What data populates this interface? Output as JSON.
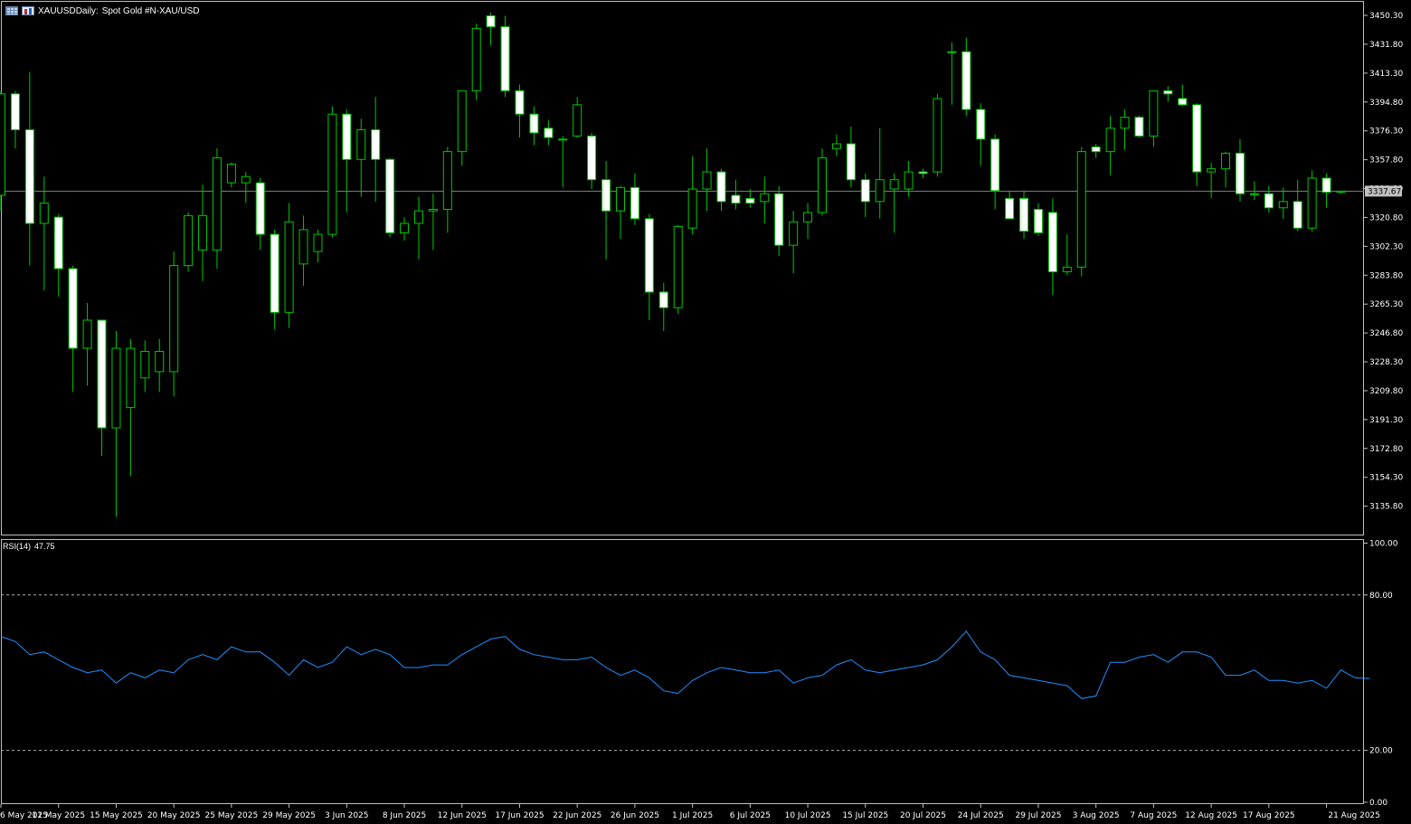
{
  "header": {
    "symbol": "XAUUSD",
    "timeframe": "Daily:",
    "description": "Spot Gold #N-XAU/USD"
  },
  "rsi": {
    "label": "RSI(14)",
    "value": "47.75"
  },
  "current_price_label": "3337.67",
  "colors": {
    "background": "#000000",
    "axis": "#c0c0c0",
    "candle_up_body": "#000000",
    "candle_down_body": "#ffffff",
    "candle_body_outline": "#00c800",
    "wick": "#00c800",
    "rsi_line": "#1e90ff",
    "level_line": "#b0b0b0",
    "price_line": "#808080"
  },
  "icons": [
    "grid-icon",
    "bar-chart-icon"
  ],
  "chart_data": [
    {
      "type": "candlestick",
      "title": "XAUUSD, Daily:  Spot Gold #N-XAU/USD",
      "ylim": [
        3120,
        3458
      ],
      "y_ticks": [
        "3450.30",
        "3431.80",
        "3413.30",
        "3394.80",
        "3376.30",
        "3357.80",
        "3339.30",
        "3320.80",
        "3302.30",
        "3283.80",
        "3265.30",
        "3246.80",
        "3228.30",
        "3209.80",
        "3191.30",
        "3172.80",
        "3154.30",
        "3135.80"
      ],
      "x_tick_labels": [
        "6 May 2025",
        "11 May 2025",
        "15 May 2025",
        "20 May 2025",
        "25 May 2025",
        "29 May 2025",
        "3 Jun 2025",
        "8 Jun 2025",
        "12 Jun 2025",
        "17 Jun 2025",
        "22 Jun 2025",
        "26 Jun 2025",
        "1 Jul 2025",
        "6 Jul 2025",
        "10 Jul 2025",
        "15 Jul 2025",
        "20 Jul 2025",
        "24 Jul 2025",
        "29 Jul 2025",
        "3 Aug 2025",
        "7 Aug 2025",
        "12 Aug 2025",
        "17 Aug 2025",
        "21 Aug 2025"
      ],
      "current_price": 3337.67,
      "candles": [
        {
          "o": 3335,
          "h": 3402,
          "l": 3325,
          "c": 3400
        },
        {
          "o": 3400,
          "h": 3402,
          "l": 3365,
          "c": 3377
        },
        {
          "o": 3377,
          "h": 3414,
          "l": 3290,
          "c": 3317
        },
        {
          "o": 3317,
          "h": 3347,
          "l": 3274,
          "c": 3330
        },
        {
          "o": 3321,
          "h": 3323,
          "l": 3270,
          "c": 3288
        },
        {
          "o": 3288,
          "h": 3290,
          "l": 3209,
          "c": 3237
        },
        {
          "o": 3237,
          "h": 3266,
          "l": 3213,
          "c": 3255
        },
        {
          "o": 3255,
          "h": 3255,
          "l": 3168,
          "c": 3186
        },
        {
          "o": 3186,
          "h": 3248,
          "l": 3129,
          "c": 3237
        },
        {
          "o": 3199,
          "h": 3243,
          "l": 3155,
          "c": 3237
        },
        {
          "o": 3218,
          "h": 3242,
          "l": 3209,
          "c": 3235
        },
        {
          "o": 3222,
          "h": 3243,
          "l": 3209,
          "c": 3235
        },
        {
          "o": 3222,
          "h": 3299,
          "l": 3206,
          "c": 3290
        },
        {
          "o": 3290,
          "h": 3324,
          "l": 3286,
          "c": 3322
        },
        {
          "o": 3300,
          "h": 3342,
          "l": 3280,
          "c": 3322
        },
        {
          "o": 3300,
          "h": 3365,
          "l": 3288,
          "c": 3359
        },
        {
          "o": 3343,
          "h": 3356,
          "l": 3340,
          "c": 3355
        },
        {
          "o": 3343,
          "h": 3350,
          "l": 3330,
          "c": 3347
        },
        {
          "o": 3343,
          "h": 3346,
          "l": 3300,
          "c": 3310
        },
        {
          "o": 3310,
          "h": 3313,
          "l": 3249,
          "c": 3260
        },
        {
          "o": 3260,
          "h": 3330,
          "l": 3250,
          "c": 3318
        },
        {
          "o": 3291,
          "h": 3322,
          "l": 3277,
          "c": 3313
        },
        {
          "o": 3299,
          "h": 3313,
          "l": 3292,
          "c": 3310
        },
        {
          "o": 3310,
          "h": 3392,
          "l": 3308,
          "c": 3387
        },
        {
          "o": 3387,
          "h": 3390,
          "l": 3324,
          "c": 3358
        },
        {
          "o": 3358,
          "h": 3384,
          "l": 3334,
          "c": 3377
        },
        {
          "o": 3377,
          "h": 3398,
          "l": 3331,
          "c": 3358
        },
        {
          "o": 3358,
          "h": 3359,
          "l": 3308,
          "c": 3311
        },
        {
          "o": 3311,
          "h": 3321,
          "l": 3306,
          "c": 3317
        },
        {
          "o": 3317,
          "h": 3334,
          "l": 3294,
          "c": 3325
        },
        {
          "o": 3325,
          "h": 3336,
          "l": 3300,
          "c": 3326
        },
        {
          "o": 3326,
          "h": 3366,
          "l": 3311,
          "c": 3363
        },
        {
          "o": 3363,
          "h": 3398,
          "l": 3354,
          "c": 3402
        },
        {
          "o": 3402,
          "h": 3445,
          "l": 3396,
          "c": 3442
        },
        {
          "o": 3450,
          "h": 3452,
          "l": 3431,
          "c": 3443
        },
        {
          "o": 3443,
          "h": 3450,
          "l": 3398,
          "c": 3402
        },
        {
          "o": 3402,
          "h": 3406,
          "l": 3372,
          "c": 3387
        },
        {
          "o": 3387,
          "h": 3392,
          "l": 3367,
          "c": 3375
        },
        {
          "o": 3378,
          "h": 3383,
          "l": 3367,
          "c": 3372
        },
        {
          "o": 3371,
          "h": 3373,
          "l": 3340,
          "c": 3371
        },
        {
          "o": 3373,
          "h": 3398,
          "l": 3372,
          "c": 3393
        },
        {
          "o": 3373,
          "h": 3375,
          "l": 3339,
          "c": 3345
        },
        {
          "o": 3345,
          "h": 3357,
          "l": 3294,
          "c": 3325
        },
        {
          "o": 3325,
          "h": 3341,
          "l": 3307,
          "c": 3340
        },
        {
          "o": 3340,
          "h": 3349,
          "l": 3316,
          "c": 3320
        },
        {
          "o": 3320,
          "h": 3323,
          "l": 3255,
          "c": 3273
        },
        {
          "o": 3273,
          "h": 3279,
          "l": 3248,
          "c": 3263
        },
        {
          "o": 3263,
          "h": 3316,
          "l": 3259,
          "c": 3315
        },
        {
          "o": 3314,
          "h": 3360,
          "l": 3310,
          "c": 3339
        },
        {
          "o": 3339,
          "h": 3365,
          "l": 3325,
          "c": 3350
        },
        {
          "o": 3350,
          "h": 3352,
          "l": 3325,
          "c": 3331
        },
        {
          "o": 3335,
          "h": 3345,
          "l": 3326,
          "c": 3330
        },
        {
          "o": 3333,
          "h": 3339,
          "l": 3327,
          "c": 3330
        },
        {
          "o": 3331,
          "h": 3347,
          "l": 3317,
          "c": 3336
        },
        {
          "o": 3336,
          "h": 3341,
          "l": 3296,
          "c": 3303
        },
        {
          "o": 3303,
          "h": 3325,
          "l": 3285,
          "c": 3318
        },
        {
          "o": 3318,
          "h": 3330,
          "l": 3307,
          "c": 3324
        },
        {
          "o": 3324,
          "h": 3365,
          "l": 3322,
          "c": 3359
        },
        {
          "o": 3365,
          "h": 3374,
          "l": 3360,
          "c": 3368
        },
        {
          "o": 3368,
          "h": 3379,
          "l": 3340,
          "c": 3345
        },
        {
          "o": 3345,
          "h": 3349,
          "l": 3321,
          "c": 3331
        },
        {
          "o": 3331,
          "h": 3378,
          "l": 3320,
          "c": 3345
        },
        {
          "o": 3339,
          "h": 3349,
          "l": 3311,
          "c": 3345
        },
        {
          "o": 3339,
          "h": 3357,
          "l": 3334,
          "c": 3350
        },
        {
          "o": 3350,
          "h": 3352,
          "l": 3346,
          "c": 3349
        },
        {
          "o": 3350,
          "h": 3400,
          "l": 3347,
          "c": 3397
        },
        {
          "o": 3427,
          "h": 3433,
          "l": 3393,
          "c": 3427
        },
        {
          "o": 3427,
          "h": 3436,
          "l": 3386,
          "c": 3390
        },
        {
          "o": 3390,
          "h": 3394,
          "l": 3354,
          "c": 3371
        },
        {
          "o": 3371,
          "h": 3374,
          "l": 3326,
          "c": 3338
        },
        {
          "o": 3333,
          "h": 3338,
          "l": 3320,
          "c": 3320
        },
        {
          "o": 3333,
          "h": 3338,
          "l": 3307,
          "c": 3312
        },
        {
          "o": 3326,
          "h": 3330,
          "l": 3309,
          "c": 3311
        },
        {
          "o": 3324,
          "h": 3333,
          "l": 3271,
          "c": 3286
        },
        {
          "o": 3286,
          "h": 3310,
          "l": 3284,
          "c": 3289
        },
        {
          "o": 3289,
          "h": 3366,
          "l": 3283,
          "c": 3363
        },
        {
          "o": 3366,
          "h": 3368,
          "l": 3359,
          "c": 3363
        },
        {
          "o": 3363,
          "h": 3386,
          "l": 3348,
          "c": 3378
        },
        {
          "o": 3378,
          "h": 3390,
          "l": 3364,
          "c": 3385
        },
        {
          "o": 3385,
          "h": 3386,
          "l": 3372,
          "c": 3373
        },
        {
          "o": 3373,
          "h": 3402,
          "l": 3366,
          "c": 3402
        },
        {
          "o": 3402,
          "h": 3405,
          "l": 3395,
          "c": 3400
        },
        {
          "o": 3397,
          "h": 3406,
          "l": 3392,
          "c": 3393
        },
        {
          "o": 3393,
          "h": 3394,
          "l": 3341,
          "c": 3350
        },
        {
          "o": 3350,
          "h": 3356,
          "l": 3333,
          "c": 3352
        },
        {
          "o": 3352,
          "h": 3363,
          "l": 3340,
          "c": 3362
        },
        {
          "o": 3362,
          "h": 3371,
          "l": 3331,
          "c": 3336
        },
        {
          "o": 3336,
          "h": 3344,
          "l": 3332,
          "c": 3336
        },
        {
          "o": 3336,
          "h": 3341,
          "l": 3324,
          "c": 3327
        },
        {
          "o": 3327,
          "h": 3340,
          "l": 3320,
          "c": 3331
        },
        {
          "o": 3331,
          "h": 3345,
          "l": 3312,
          "c": 3314
        },
        {
          "o": 3314,
          "h": 3351,
          "l": 3312,
          "c": 3346
        },
        {
          "o": 3346,
          "h": 3349,
          "l": 3327,
          "c": 3337
        },
        {
          "o": 3337,
          "h": 3338,
          "l": 3336,
          "c": 3337.67
        }
      ]
    },
    {
      "type": "line",
      "title": "RSI(14) 47.75",
      "ylim": [
        0,
        100
      ],
      "y_ticks": [
        "100.00",
        "80.00",
        "20.00",
        "0.00"
      ],
      "levels": [
        80,
        20
      ],
      "series": [
        {
          "values": [
            64,
            62,
            57,
            58,
            55,
            52,
            50,
            51,
            46,
            50,
            48,
            51,
            50,
            55,
            57,
            55,
            60,
            58,
            58,
            54,
            49,
            55,
            52,
            54,
            60,
            57,
            59,
            57,
            52,
            52,
            53,
            53,
            57,
            60,
            63,
            64,
            59,
            57,
            56,
            55,
            55,
            56,
            52,
            49,
            51,
            48,
            43,
            42,
            47,
            50,
            52,
            51,
            50,
            50,
            51,
            46,
            48,
            49,
            53,
            55,
            51,
            50,
            51,
            52,
            53,
            55,
            60,
            66,
            58,
            55,
            49,
            48,
            47,
            46,
            45,
            40,
            41,
            54,
            54,
            56,
            57,
            54,
            58,
            58,
            56,
            49,
            49,
            51,
            47,
            47,
            46,
            47,
            44,
            51,
            48,
            47.75
          ]
        }
      ]
    }
  ]
}
